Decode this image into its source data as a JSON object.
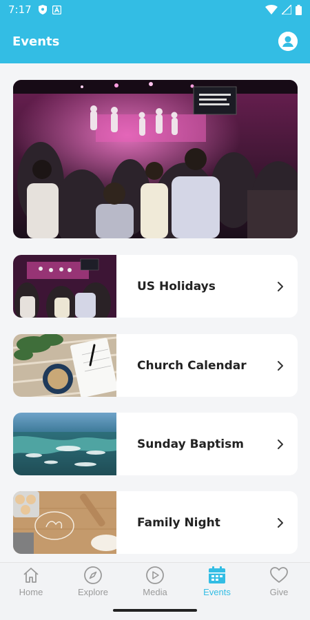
{
  "status_bar": {
    "time": "7:17"
  },
  "header": {
    "title": "Events"
  },
  "events": [
    {
      "label": "US Holidays"
    },
    {
      "label": "Church Calendar"
    },
    {
      "label": "Sunday Baptism"
    },
    {
      "label": "Family Night"
    }
  ],
  "tabs": [
    {
      "label": "Home",
      "icon": "home-icon",
      "active": false
    },
    {
      "label": "Explore",
      "icon": "compass-icon",
      "active": false
    },
    {
      "label": "Media",
      "icon": "play-icon",
      "active": false
    },
    {
      "label": "Events",
      "icon": "calendar-icon",
      "active": true
    },
    {
      "label": "Give",
      "icon": "heart-icon",
      "active": false
    }
  ],
  "colors": {
    "accent": "#33bde4",
    "inactive": "#9a9a9a"
  }
}
